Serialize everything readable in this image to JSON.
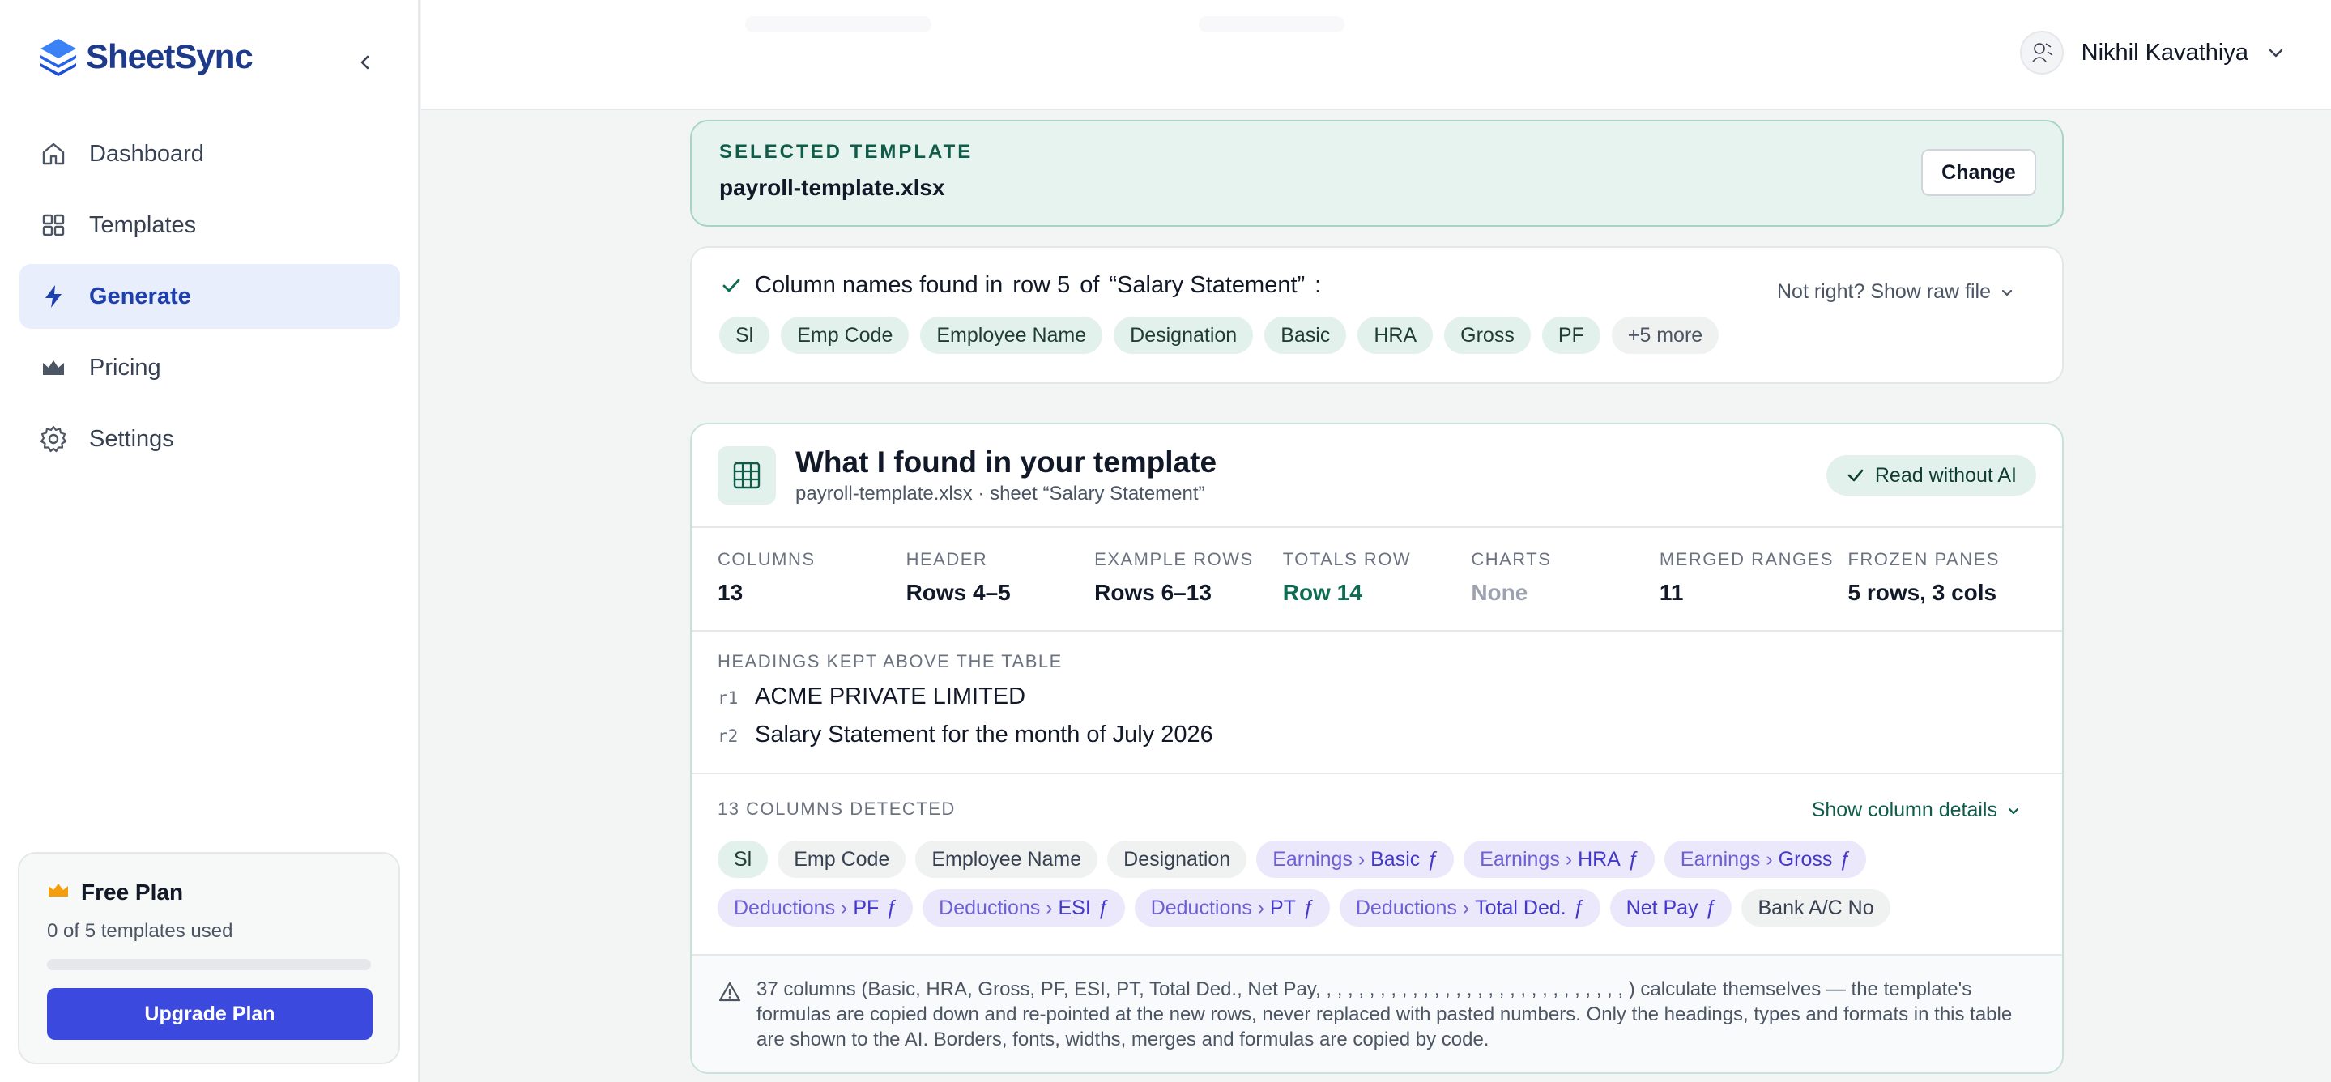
{
  "brand": {
    "name": "SheetSync"
  },
  "sidebar": {
    "items": [
      {
        "label": "Dashboard",
        "icon": "home-icon"
      },
      {
        "label": "Templates",
        "icon": "grid-icon"
      },
      {
        "label": "Generate",
        "icon": "bolt-icon",
        "active": true
      },
      {
        "label": "Pricing",
        "icon": "crown-icon"
      },
      {
        "label": "Settings",
        "icon": "gear-icon"
      }
    ],
    "plan": {
      "title": "Free Plan",
      "usage": "0 of 5 templates used",
      "progress": 0,
      "upgrade_label": "Upgrade Plan"
    }
  },
  "user": {
    "name": "Nikhil Kavathiya"
  },
  "selected_template": {
    "caption": "SELECTED TEMPLATE",
    "filename": "payroll-template.xlsx",
    "change_label": "Change"
  },
  "column_names": {
    "prefix": "Column names found in",
    "row": "row 5",
    "of": "of",
    "sheet": "“Salary Statement”",
    "suffix": ":",
    "raw_link": "Not right? Show raw file",
    "chips": [
      "Sl",
      "Emp Code",
      "Employee Name",
      "Designation",
      "Basic",
      "HRA",
      "Gross",
      "PF"
    ],
    "more": "+5 more"
  },
  "found": {
    "title": "What I found in your template",
    "subtitle": "payroll-template.xlsx · sheet “Salary Statement”",
    "badge": "Read without AI",
    "stats": [
      {
        "key": "COLUMNS",
        "value": "13"
      },
      {
        "key": "HEADER",
        "value": "Rows 4–5"
      },
      {
        "key": "EXAMPLE ROWS",
        "value": "Rows 6–13"
      },
      {
        "key": "TOTALS ROW",
        "value": "Row 14"
      },
      {
        "key": "CHARTS",
        "value": "None"
      },
      {
        "key": "MERGED RANGES",
        "value": "11"
      },
      {
        "key": "FROZEN PANES",
        "value": "5 rows, 3 cols"
      }
    ],
    "headings_caption": "HEADINGS KEPT ABOVE THE TABLE",
    "headings": [
      {
        "row": "r1",
        "text": "ACME PRIVATE LIMITED"
      },
      {
        "row": "r2",
        "text": "Salary Statement for the month of July 2026"
      }
    ],
    "columns_caption": "13 COLUMNS DETECTED",
    "show_details": "Show column details",
    "columns": {
      "plain1": [
        "Sl",
        "Emp Code",
        "Employee Name",
        "Designation"
      ],
      "earnings": [
        {
          "group": "Earnings ›",
          "name": "Basic",
          "f": "ƒ"
        },
        {
          "group": "Earnings ›",
          "name": "HRA",
          "f": "ƒ"
        },
        {
          "group": "Earnings ›",
          "name": "Gross",
          "f": "ƒ"
        }
      ],
      "deductions": [
        {
          "group": "Deductions ›",
          "name": "PF",
          "f": "ƒ"
        },
        {
          "group": "Deductions ›",
          "name": "ESI",
          "f": "ƒ"
        },
        {
          "group": "Deductions ›",
          "name": "PT",
          "f": "ƒ"
        },
        {
          "group": "Deductions ›",
          "name": "Total Ded.",
          "f": "ƒ"
        }
      ],
      "netpay": {
        "name": "Net Pay",
        "f": "ƒ"
      },
      "bank": "Bank A/C No"
    },
    "notice": "37 columns (Basic, HRA, Gross, PF, ESI, PT, Total Ded., Net Pay, , , , , , , , , , , , , , , , , , , , , , , , , , , , , ) calculate themselves — the template's formulas are copied down and re-pointed at the new rows, never replaced with pasted numbers. Only the headings, types and formats in this table are shown to the AI. Borders, fonts, widths, merges and formulas are copied by code."
  }
}
